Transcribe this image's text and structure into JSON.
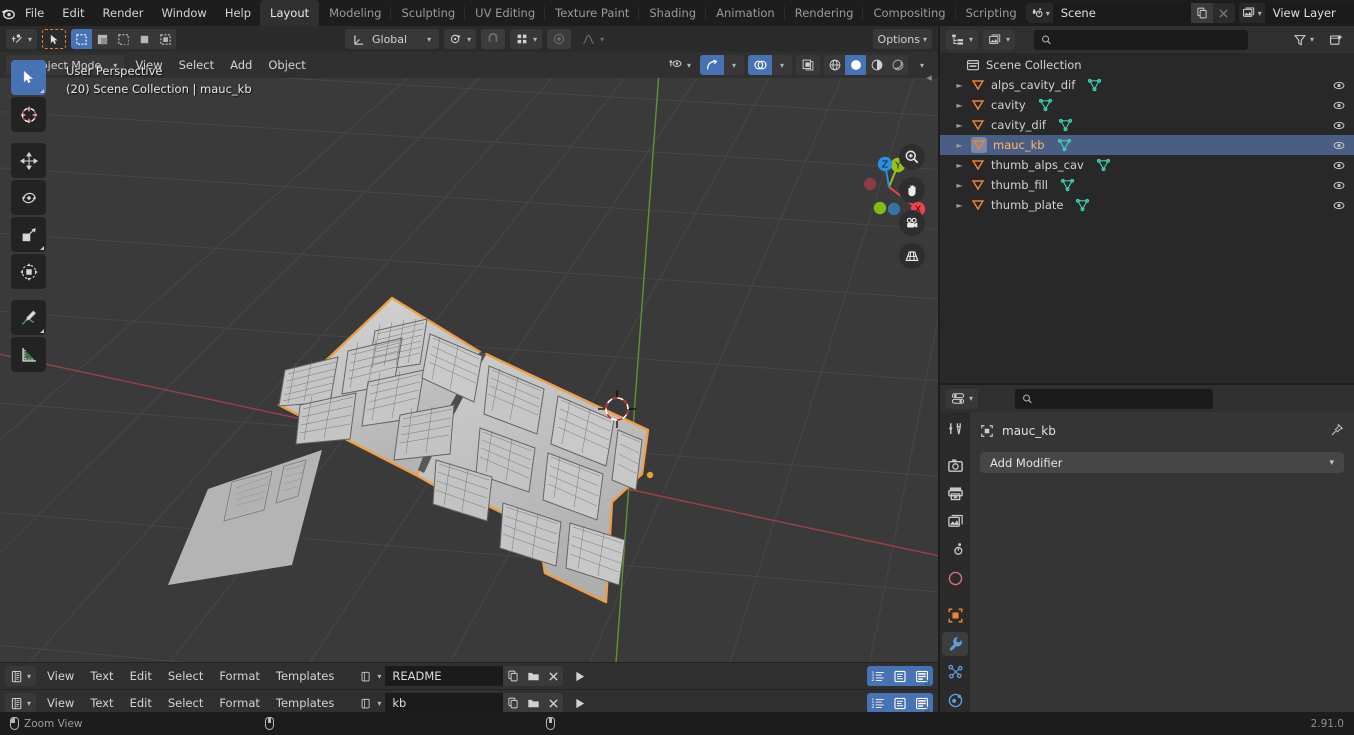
{
  "app": {
    "name": "Blender",
    "version_label": "2.91.0"
  },
  "topbar": {
    "menus": [
      "File",
      "Edit",
      "Render",
      "Window",
      "Help"
    ],
    "workspaces": [
      {
        "label": "Layout",
        "active": true
      },
      {
        "label": "Modeling",
        "active": false
      },
      {
        "label": "Sculpting",
        "active": false
      },
      {
        "label": "UV Editing",
        "active": false
      },
      {
        "label": "Texture Paint",
        "active": false
      },
      {
        "label": "Shading",
        "active": false
      },
      {
        "label": "Animation",
        "active": false
      },
      {
        "label": "Rendering",
        "active": false
      },
      {
        "label": "Compositing",
        "active": false
      },
      {
        "label": "Scripting",
        "active": false
      }
    ],
    "scene_field": "Scene",
    "viewlayer_field": "View Layer",
    "scene_icon": "scene-icon",
    "viewlayer_icon": "view-layer-icon",
    "duplicate_icon": "duplicate-icon",
    "unlink_icon": "x-icon"
  },
  "viewport": {
    "toolrow": {
      "transform_orientation": "Global",
      "options_label": "Options",
      "editor_type_icon": "editor-type-icon",
      "cursor_tool_icon": "tweak-cursor-icon",
      "select_modes": [
        "set",
        "extend",
        "subtract",
        "invert",
        "intersect"
      ],
      "pivot_icon": "pivot-point-icon",
      "snap_icon": "magnet-icon",
      "snap_target_icon": "snap-grid-icon",
      "proportional_icon": "proportional-edit-icon",
      "falloff_icon": "falloff-curve-icon"
    },
    "header": {
      "mode": "Object Mode",
      "menus": [
        "View",
        "Select",
        "Add",
        "Object"
      ],
      "visibility_icon": "show-hide-icon",
      "gizmo_icon": "gizmo-icon",
      "overlays_icon": "overlays-icon",
      "xray_icon": "toggle-xray-icon",
      "shading_modes": [
        "wireframe",
        "solid",
        "material-preview",
        "rendered"
      ],
      "shading_active": "solid"
    },
    "overlay": {
      "perspective": "User Perspective",
      "scene_info": "(20) Scene Collection | mauc_kb"
    },
    "tools": [
      {
        "name": "tweak-tool",
        "icon": "cursor-arrow-icon",
        "active": true
      },
      {
        "name": "cursor-tool",
        "icon": "3d-cursor-icon",
        "active": false
      },
      {
        "name": "move-tool",
        "icon": "move-arrows-icon",
        "active": false
      },
      {
        "name": "rotate-tool",
        "icon": "rotate-icon",
        "active": false
      },
      {
        "name": "scale-tool",
        "icon": "scale-icon",
        "active": false
      },
      {
        "name": "transform-tool",
        "icon": "transform-icon",
        "active": false
      },
      {
        "name": "annotate-tool",
        "icon": "pencil-icon",
        "active": false
      },
      {
        "name": "measure-tool",
        "icon": "ruler-icon",
        "active": false
      }
    ],
    "nav_buttons": [
      {
        "name": "zoom-view",
        "icon": "magnifier-plus-icon"
      },
      {
        "name": "pan-view",
        "icon": "hand-icon"
      },
      {
        "name": "camera-view",
        "icon": "camera-icon"
      },
      {
        "name": "toggle-orthographic",
        "icon": "perspective-grid-icon"
      }
    ],
    "axis_gizmo": {
      "x_label": "X",
      "y_label": "Y",
      "z_label": "Z",
      "x_color": "#ec4252",
      "y_color": "#96c11e",
      "z_color": "#2a8fe0"
    },
    "colors": {
      "background": "#3a3a3a",
      "grid_line": "#484848",
      "x_axis": "#a03f4a",
      "y_axis": "#5a8f33",
      "selection_outline": "#ed9e4b",
      "object_surface": "#c8c8c8"
    }
  },
  "text_editors": [
    {
      "menus": [
        "View",
        "Text",
        "Edit",
        "Select",
        "Format",
        "Templates"
      ],
      "datablock": "README",
      "editor_icon": "text-editor-icon",
      "new_icon": "new-text-icon",
      "open_icon": "open-folder-icon",
      "unlink_icon": "x-icon",
      "run_icon": "run-script-icon",
      "toggles": [
        {
          "name": "line-numbers-toggle",
          "icon": "line-numbers-icon",
          "on": true
        },
        {
          "name": "word-wrap-toggle",
          "icon": "word-wrap-icon",
          "on": true
        },
        {
          "name": "syntax-highlight-toggle",
          "icon": "syntax-highlight-icon",
          "on": true
        }
      ]
    },
    {
      "menus": [
        "View",
        "Text",
        "Edit",
        "Select",
        "Format",
        "Templates"
      ],
      "datablock": "kb",
      "editor_icon": "text-editor-icon",
      "new_icon": "new-text-icon",
      "open_icon": "open-folder-icon",
      "unlink_icon": "x-icon",
      "run_icon": "run-script-icon",
      "toggles": [
        {
          "name": "line-numbers-toggle",
          "icon": "line-numbers-icon",
          "on": true
        },
        {
          "name": "word-wrap-toggle",
          "icon": "word-wrap-icon",
          "on": true
        },
        {
          "name": "syntax-highlight-toggle",
          "icon": "syntax-highlight-icon",
          "on": true
        }
      ]
    }
  ],
  "outliner": {
    "display_mode_icon": "outliner-display-icon",
    "filter_id_icon": "filter-id-icon",
    "search_placeholder": "",
    "search_value": "",
    "filter_icon": "funnel-icon",
    "new_collection_icon": "new-collection-icon",
    "root": {
      "label": "Scene Collection",
      "icon": "collection-icon"
    },
    "items": [
      {
        "label": "alps_cavity_dif",
        "icon": "object-mesh-icon",
        "data_icon": "mesh-data-icon",
        "selected": false,
        "visible": true
      },
      {
        "label": "cavity",
        "icon": "object-mesh-icon",
        "data_icon": "mesh-data-icon",
        "selected": false,
        "visible": true
      },
      {
        "label": "cavity_dif",
        "icon": "object-mesh-icon",
        "data_icon": "mesh-data-icon",
        "selected": false,
        "visible": true
      },
      {
        "label": "mauc_kb",
        "icon": "object-mesh-icon",
        "data_icon": "mesh-data-icon",
        "selected": true,
        "visible": true
      },
      {
        "label": "thumb_alps_cav",
        "icon": "object-mesh-icon",
        "data_icon": "mesh-data-icon",
        "selected": false,
        "visible": true
      },
      {
        "label": "thumb_fill",
        "icon": "object-mesh-icon",
        "data_icon": "mesh-data-icon",
        "selected": false,
        "visible": true
      },
      {
        "label": "thumb_plate",
        "icon": "object-mesh-icon",
        "data_icon": "mesh-data-icon",
        "selected": false,
        "visible": true
      }
    ],
    "colors": {
      "selected_row": "#4a5d85",
      "selected_text": "#ffb661",
      "object_icon": "#e9833a",
      "data_icon": "#3ecfb0"
    }
  },
  "properties": {
    "editor_type_icon": "properties-editor-icon",
    "search_placeholder": "",
    "search_value": "",
    "breadcrumb_object": "mauc_kb",
    "breadcrumb_icon": "object-properties-icon",
    "pin_icon": "pin-icon",
    "add_modifier_label": "Add Modifier",
    "tabs": [
      {
        "name": "tab-tool",
        "icon": "tool-icon",
        "active": false,
        "color": "#c8c8c8"
      },
      {
        "name": "tab-render",
        "icon": "camera-back-icon",
        "active": false,
        "color": "#c8c8c8"
      },
      {
        "name": "tab-output",
        "icon": "printer-icon",
        "active": false,
        "color": "#c8c8c8"
      },
      {
        "name": "tab-view-layer",
        "icon": "images-icon",
        "active": false,
        "color": "#c8c8c8"
      },
      {
        "name": "tab-scene",
        "icon": "cone-droplet-icon",
        "active": false,
        "color": "#c8c8c8"
      },
      {
        "name": "tab-world",
        "icon": "world-globe-icon",
        "active": false,
        "color": "#e06b7d"
      },
      {
        "name": "tab-object",
        "icon": "object-square-icon",
        "active": false,
        "color": "#e9833a"
      },
      {
        "name": "tab-modifiers",
        "icon": "wrench-icon",
        "active": true,
        "color": "#5e9ddb"
      },
      {
        "name": "tab-particles",
        "icon": "particles-icon",
        "active": false,
        "color": "#5e9ddb"
      },
      {
        "name": "tab-physics",
        "icon": "physics-orbit-icon",
        "active": false,
        "color": "#5e9ddb"
      }
    ]
  },
  "statusbar": {
    "hints": [
      {
        "icon": "mouse-left-icon",
        "label": "Zoom View"
      },
      {
        "icon": "mouse-middle-icon",
        "label": ""
      },
      {
        "icon": "mouse-right-icon",
        "label": ""
      }
    ],
    "version": "2.91.0"
  }
}
